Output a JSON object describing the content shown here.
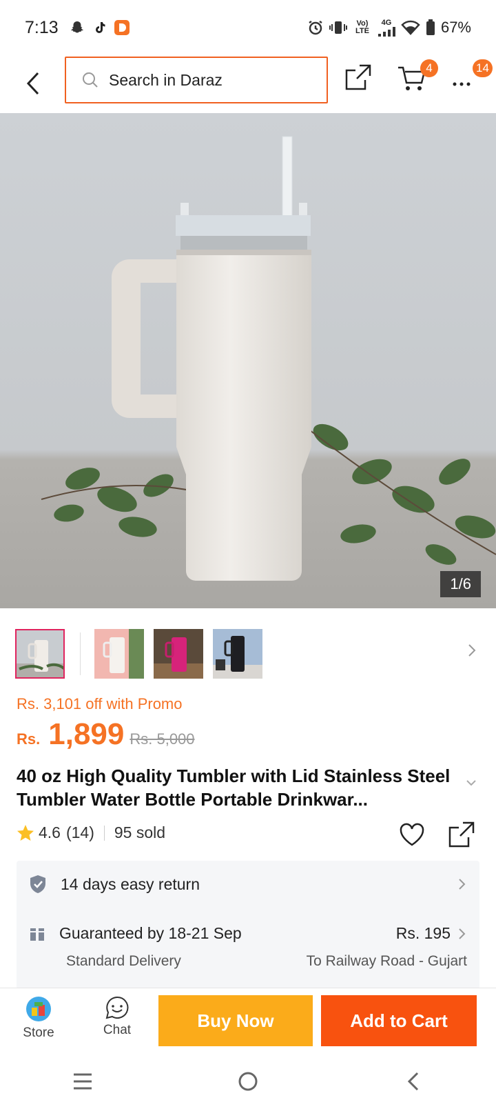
{
  "status_bar": {
    "time": "7:13",
    "battery": "67%",
    "network_top": "Vo) LTE",
    "network_4g": "4G"
  },
  "header": {
    "search_placeholder": "Search in Daraz",
    "cart_badge": "4",
    "more_badge": "14"
  },
  "gallery": {
    "counter": "1/6"
  },
  "product": {
    "promo_text": "Rs. 3,101 off with Promo",
    "currency": "Rs.",
    "price": "1,899",
    "original_price": "Rs. 5,000",
    "title": "40 oz High Quality Tumbler with Lid Stainless Steel Tumbler Water Bottle Portable Drinkwar...",
    "rating": "4.6",
    "rating_count": "(14)",
    "sold": "95 sold"
  },
  "info": {
    "return_text": "14 days easy return",
    "delivery_text": "Guaranteed by 18-21 Sep",
    "delivery_price": "Rs. 195",
    "delivery_type": "Standard Delivery",
    "delivery_location": "To Railway Road - Gujart"
  },
  "bottom_bar": {
    "store_label": "Store",
    "chat_label": "Chat",
    "buy_now_label": "Buy Now",
    "add_to_cart_label": "Add to Cart"
  },
  "colors": {
    "accent": "#f57224",
    "buy_now": "#fbab1a",
    "add_to_cart": "#f8520f"
  }
}
